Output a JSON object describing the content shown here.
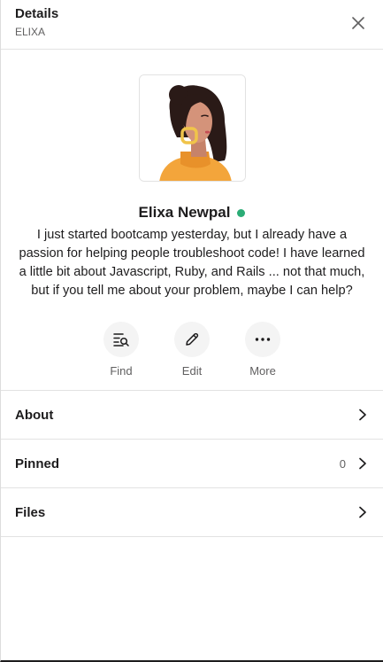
{
  "header": {
    "title": "Details",
    "subtitle": "ELIXA"
  },
  "profile": {
    "name": "Elixa Newpal",
    "status": "active",
    "bio": "I just started bootcamp yesterday, but I already have a passion for helping people troubleshoot code! I have learned a little bit about Javascript, Ruby, and Rails ... not that much, but if you tell me about your problem, maybe I can help?"
  },
  "actions": [
    {
      "label": "Find",
      "icon": "find-icon"
    },
    {
      "label": "Edit",
      "icon": "pencil-icon"
    },
    {
      "label": "More",
      "icon": "more-icon"
    }
  ],
  "rows": [
    {
      "label": "About"
    },
    {
      "label": "Pinned",
      "count": "0"
    },
    {
      "label": "Files"
    }
  ],
  "colors": {
    "presence": "#2bac76",
    "text": "#1d1c1d",
    "muted": "#616061",
    "divider": "#e2e2e2"
  }
}
